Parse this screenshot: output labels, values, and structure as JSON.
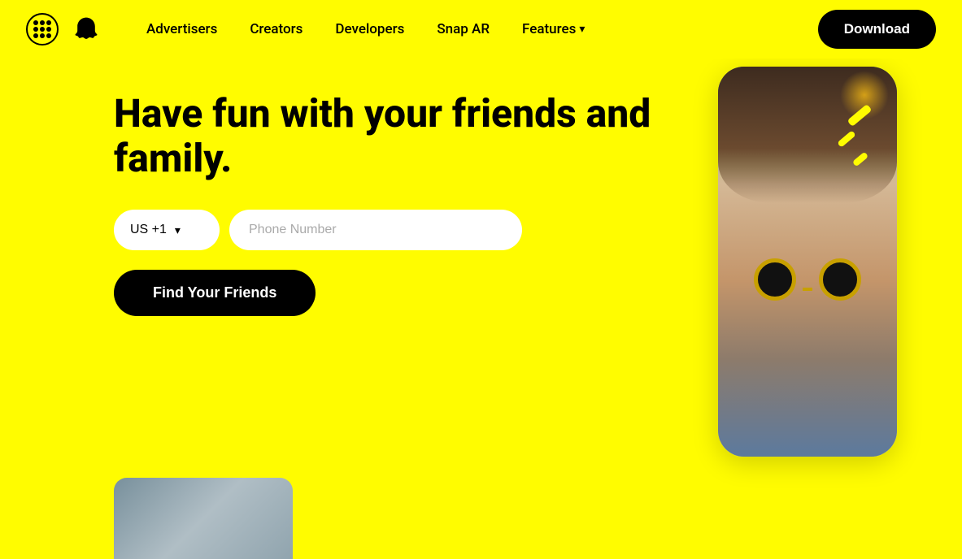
{
  "nav": {
    "grid_label": "menu",
    "logo_label": "Snapchat",
    "links": [
      {
        "id": "advertisers",
        "label": "Advertisers"
      },
      {
        "id": "creators",
        "label": "Creators"
      },
      {
        "id": "developers",
        "label": "Developers"
      },
      {
        "id": "snap-ar",
        "label": "Snap AR"
      },
      {
        "id": "features",
        "label": "Features",
        "has_chevron": true
      }
    ],
    "download_label": "Download"
  },
  "hero": {
    "title_line1": "Have fun with your friends and",
    "title_line2": "family.",
    "country_code": "US +1",
    "phone_placeholder": "Phone Number",
    "cta_label": "Find Your Friends"
  },
  "colors": {
    "background": "#FFFC00",
    "button_bg": "#000000",
    "button_text": "#FFFFFF",
    "input_bg": "#FFFFFF"
  }
}
